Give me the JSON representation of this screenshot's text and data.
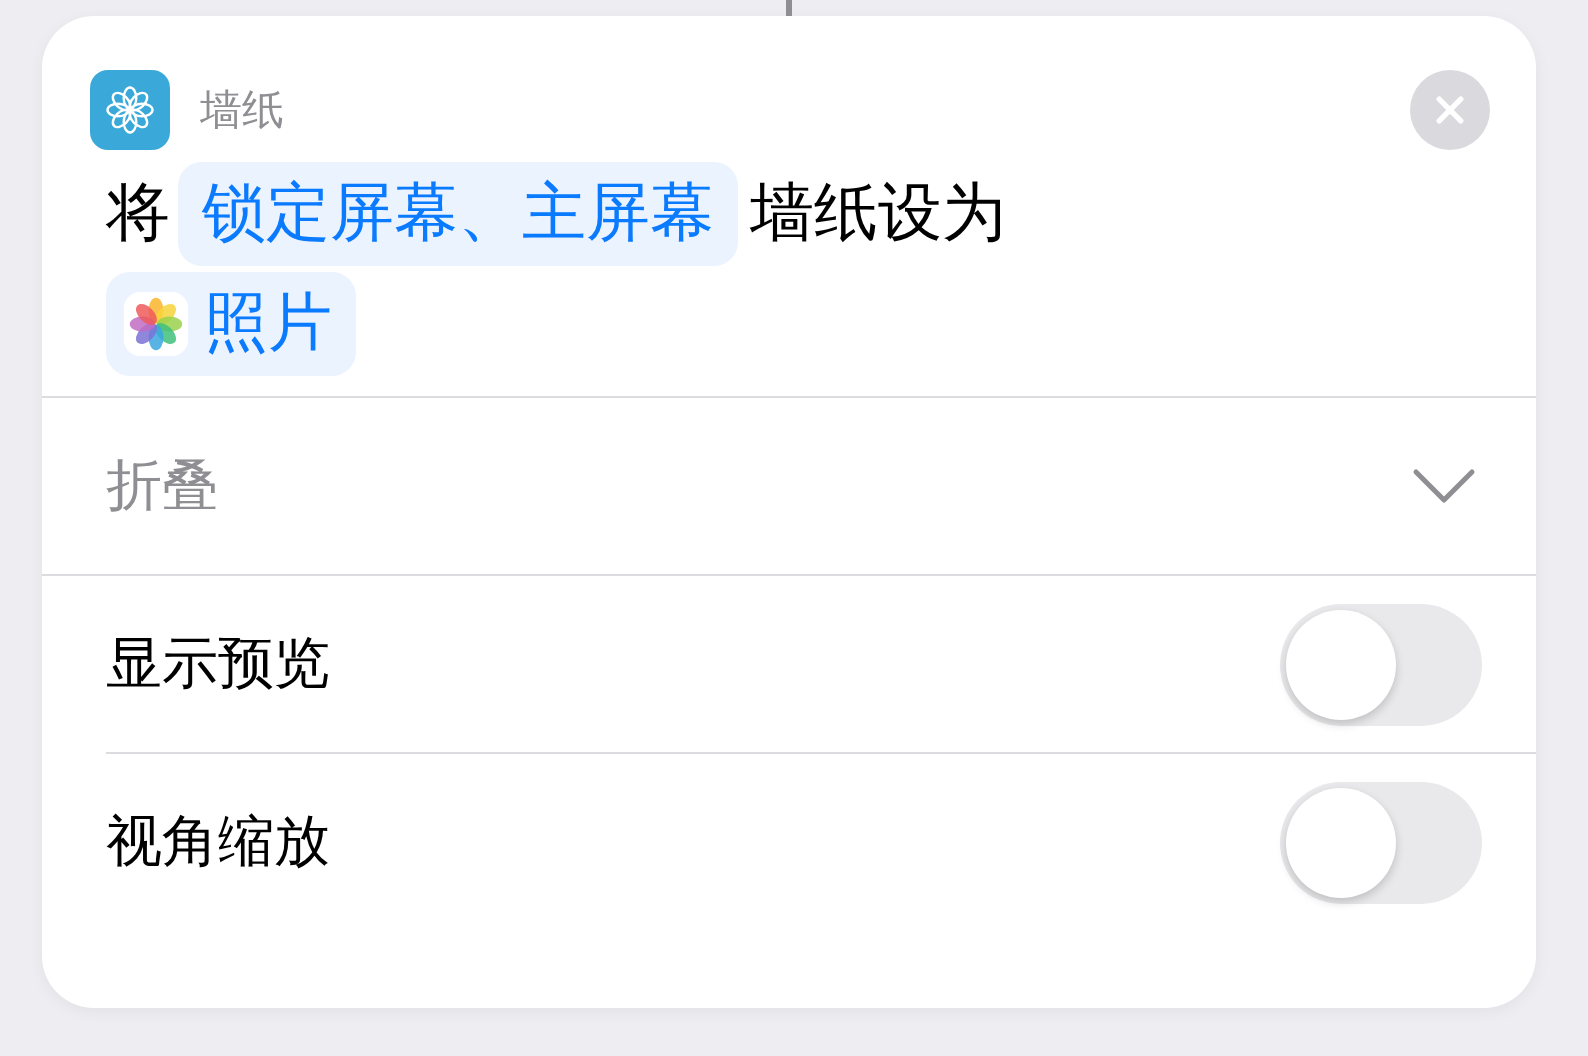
{
  "action": {
    "app": "墙纸",
    "sentence": [
      {
        "kind": "text",
        "text": "将"
      },
      {
        "kind": "token",
        "text": "锁定屏幕、主屏幕"
      },
      {
        "kind": "text",
        "text": "墙纸设为"
      },
      {
        "kind": "app-token",
        "text": "照片"
      }
    ],
    "collapse": {
      "label": "折叠"
    },
    "options": [
      {
        "label": "显示预览",
        "on": false
      },
      {
        "label": "视角缩放",
        "on": false
      }
    ]
  }
}
